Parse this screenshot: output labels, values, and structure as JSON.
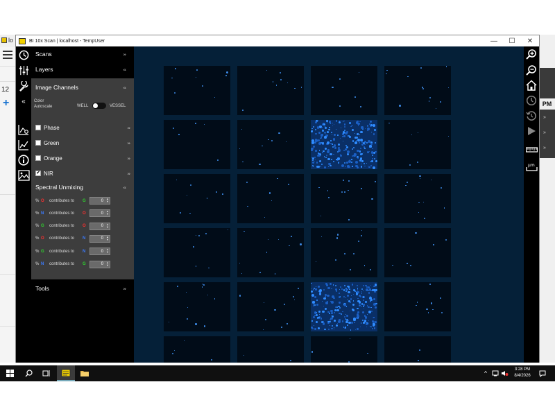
{
  "background_window": {
    "tab_label": "lo",
    "number": "12",
    "right_label": "PM"
  },
  "window": {
    "title": "BI 10x Scan | localhost - TempUser",
    "minimize": "—",
    "maximize": "☐",
    "close": "✕"
  },
  "panel": {
    "collapse_glyph": "«",
    "sections": {
      "scans": "Scans",
      "layers": "Layers",
      "image_channels": "Image Channels",
      "tools": "Tools"
    },
    "autoscale": {
      "label_line1": "Color",
      "label_line2": "Autoscale",
      "left_option": "WELL",
      "right_option": "VESSEL",
      "selected": "WELL"
    },
    "channels": [
      {
        "label": "Phase",
        "checked": false
      },
      {
        "label": "Green",
        "checked": false
      },
      {
        "label": "Orange",
        "checked": false
      },
      {
        "label": "NIR",
        "checked": true
      }
    ],
    "spectral_unmixing": {
      "title": "Spectral Unmixing",
      "rows": [
        {
          "pct": "%",
          "from": "O",
          "text": "contributes to",
          "to": "G",
          "value": "0"
        },
        {
          "pct": "%",
          "from": "N",
          "text": "contributes to",
          "to": "O",
          "value": "0"
        },
        {
          "pct": "%",
          "from": "G",
          "text": "contributes to",
          "to": "O",
          "value": "0"
        },
        {
          "pct": "%",
          "from": "O",
          "text": "contributes to",
          "to": "N",
          "value": "0"
        },
        {
          "pct": "%",
          "from": "G",
          "text": "contributes to",
          "to": "N",
          "value": "0"
        },
        {
          "pct": "%",
          "from": "N",
          "text": "contributes to",
          "to": "G",
          "value": "0"
        }
      ]
    }
  },
  "canvas": {
    "grid_rows": 6,
    "grid_cols": 4,
    "bright_wells": [
      [
        1,
        2
      ],
      [
        4,
        2
      ]
    ]
  },
  "colors": {
    "accent_blue": "#3a86e0",
    "orange_red": "#ff3030",
    "green": "#2fd22f",
    "nir_blue": "#3b7bff"
  },
  "taskbar": {
    "time": "3:28 PM",
    "date": "8/4/2026"
  }
}
